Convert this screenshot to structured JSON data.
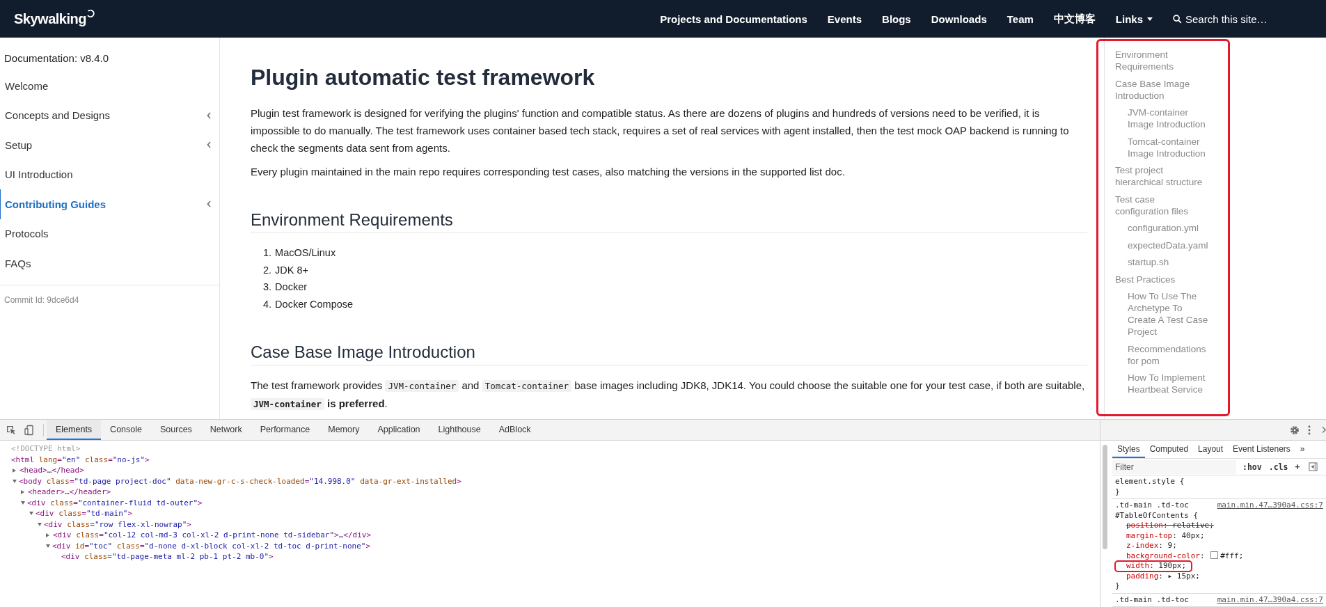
{
  "navbar": {
    "logo": "Skywalking",
    "items": [
      {
        "label": "Projects and Documentations"
      },
      {
        "label": "Events"
      },
      {
        "label": "Blogs"
      },
      {
        "label": "Downloads"
      },
      {
        "label": "Team"
      },
      {
        "label": "中文博客"
      },
      {
        "label": "Links",
        "kind": "dropdown"
      }
    ],
    "search": {
      "placeholder": "Search this site…"
    }
  },
  "sidebar": {
    "title": "Documentation: v8.4.0",
    "items": [
      {
        "label": "Welcome",
        "selected": false,
        "expandable": false
      },
      {
        "label": "Concepts and Designs",
        "selected": false,
        "expandable": true
      },
      {
        "label": "Setup",
        "selected": false,
        "expandable": true
      },
      {
        "label": "UI Introduction",
        "selected": false,
        "expandable": false
      },
      {
        "label": "Contributing Guides",
        "selected": true,
        "expandable": true
      },
      {
        "label": "Protocols",
        "selected": false,
        "expandable": false
      },
      {
        "label": "FAQs",
        "selected": false,
        "expandable": false
      }
    ],
    "commit": "Commit Id: 9dce6d4"
  },
  "article": {
    "title": "Plugin automatic test framework",
    "blocks": [
      {
        "kind": "paragraph",
        "parts": [
          {
            "kind": "text",
            "text": "Plugin test framework is designed for verifying the plugins' function and compatible status. As there are dozens of plugins and hundreds of versions need to be verified, it is impossible to do manually. The test framework uses container based tech stack, requires a set of real services with agent installed, then the test mock OAP backend is running to check the segments data sent from agents."
          }
        ]
      },
      {
        "kind": "paragraph",
        "parts": [
          {
            "kind": "text",
            "text": "Every plugin maintained in the main repo requires corresponding test cases, also matching the versions in the supported list doc."
          }
        ]
      },
      {
        "kind": "heading",
        "text": "Environment Requirements"
      },
      {
        "kind": "list",
        "items": [
          {
            "number": "1.",
            "text": "MacOS/Linux"
          },
          {
            "number": "2.",
            "text": "JDK 8+"
          },
          {
            "number": "3.",
            "text": "Docker"
          },
          {
            "number": "4.",
            "text": "Docker Compose"
          }
        ]
      },
      {
        "kind": "heading",
        "text": "Case Base Image Introduction"
      },
      {
        "kind": "paragraph",
        "parts": [
          {
            "kind": "text",
            "text": "The test framework provides "
          },
          {
            "kind": "code",
            "text": "JVM-container"
          },
          {
            "kind": "text",
            "text": " and "
          },
          {
            "kind": "code",
            "text": "Tomcat-container"
          },
          {
            "kind": "text",
            "text": " base images including JDK8, JDK14. You could choose the suitable one for your test case, if both are suitable, "
          },
          {
            "kind": "strong_code",
            "text": "JVM-container"
          },
          {
            "kind": "text",
            "text": " **is preferred**."
          }
        ]
      }
    ]
  },
  "toc": {
    "highlighted": true,
    "items": [
      {
        "label": "Environment Requirements"
      },
      {
        "label": "Case Base Image Introduction",
        "children": [
          {
            "label": "JVM-container Image Introduction"
          },
          {
            "label": "Tomcat-container Image Introduction"
          }
        ]
      },
      {
        "label": "Test project hierarchical structure"
      },
      {
        "label": "Test case configuration files",
        "children": [
          {
            "label": "configuration.yml"
          },
          {
            "label": "expectedData.yaml"
          },
          {
            "label": "startup.sh"
          }
        ]
      },
      {
        "label": "Best Practices",
        "children": [
          {
            "label": "How To Use The Archetype To Create A Test Case Project"
          },
          {
            "label": "Recommendations for pom"
          },
          {
            "label": "How To Implement Heartbeat Service"
          }
        ]
      }
    ]
  },
  "devtools": {
    "tabs": [
      {
        "label": "Elements",
        "selected": true
      },
      {
        "label": "Console",
        "selected": false
      },
      {
        "label": "Sources",
        "selected": false
      },
      {
        "label": "Network",
        "selected": false
      },
      {
        "label": "Performance",
        "selected": false
      },
      {
        "label": "Memory",
        "selected": false
      },
      {
        "label": "Application",
        "selected": false
      },
      {
        "label": "Lighthouse",
        "selected": false
      },
      {
        "label": "AdBlock",
        "selected": false
      }
    ],
    "dom": [
      {
        "kind": "doctype",
        "text": "<!DOCTYPE html>"
      },
      {
        "kind": "tag",
        "text": "<html lang=\"en\" class=\"no-js\">",
        "children": [
          {
            "kind": "tag",
            "text": "<head>…</head>",
            "expanded": false
          },
          {
            "kind": "tag",
            "text": "<body class=\"td-page  project-doc\" data-new-gr-c-s-check-loaded=\"14.998.0\" data-gr-ext-installed>",
            "expanded": true,
            "children": [
              {
                "kind": "tag",
                "text": "<header>…</header>",
                "expanded": false
              },
              {
                "kind": "tag",
                "text": "<div class=\"container-fluid td-outer\">",
                "expanded": true,
                "children": [
                  {
                    "kind": "tag",
                    "text": "<div class=\"td-main\">",
                    "expanded": true,
                    "children": [
                      {
                        "kind": "tag",
                        "text": "<div class=\"row flex-xl-nowrap\">",
                        "expanded": true,
                        "children": [
                          {
                            "kind": "tag",
                            "text": "<div class=\"col-12 col-md-3 col-xl-2 d-print-none td-sidebar\">…</div>",
                            "expanded": false
                          },
                          {
                            "kind": "tag",
                            "text": "<div id=\"toc\" class=\"d-none d-xl-block col-xl-2 td-toc d-print-none\">",
                            "expanded": true,
                            "children": [
                              {
                                "kind": "tag",
                                "text": "<div class=\"td-page-meta ml-2 pb-1 pt-2 mb-0\">"
                              }
                            ]
                          }
                        ]
                      }
                    ]
                  }
                ]
              }
            ]
          }
        ]
      }
    ],
    "styles": {
      "tabs": [
        {
          "label": "Styles",
          "selected": true
        },
        {
          "label": "Computed",
          "selected": false
        },
        {
          "label": "Layout",
          "selected": false
        },
        {
          "label": "Event Listeners",
          "selected": false
        },
        {
          "label": "»",
          "selected": false
        }
      ],
      "filter": {
        "placeholder": "Filter"
      },
      "buttons": [
        ":hov",
        ".cls",
        "+"
      ],
      "rules": [
        {
          "selector": [
            "element.style {"
          ],
          "close": "}"
        },
        {
          "selector": [
            ".td-main .td-toc",
            "#TableOfContents {"
          ],
          "source": "main.min.47…390a4.css:7",
          "declarations": [
            {
              "kind": "plain",
              "text": "position: relative;",
              "overridden": true,
              "highlighted": false
            },
            {
              "kind": "plain",
              "text": "margin-top: 40px;",
              "overridden": false,
              "highlighted": false
            },
            {
              "kind": "plain",
              "text": "z-index: 9;",
              "overridden": false,
              "highlighted": false
            },
            {
              "kind": "color",
              "text": "background-color: #fff;",
              "overridden": false,
              "highlighted": false
            },
            {
              "kind": "plain",
              "text": "width: 190px;",
              "overridden": false,
              "highlighted": true
            },
            {
              "kind": "plain",
              "text": "padding: ▸ 15px;",
              "overridden": false,
              "highlighted": false
            }
          ],
          "close": "}"
        },
        {
          "selector": [
            ".td-main .td-toc"
          ],
          "source": "main.min.47…390a4.css:7"
        }
      ]
    }
  }
}
